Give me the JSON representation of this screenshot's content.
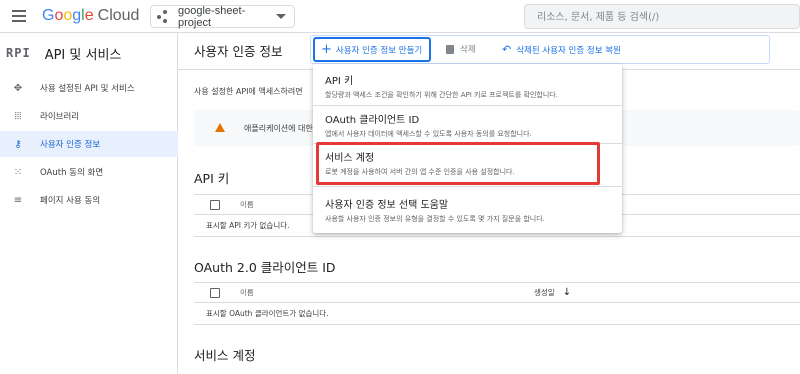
{
  "header": {
    "logo_google": "Google",
    "logo_cloud": "Cloud",
    "project_name": "google-sheet-project",
    "search_placeholder": "리소스, 문서, 제품 등 검색(/)"
  },
  "sidebar": {
    "api_logo": "RPI",
    "title": "API 및 서비스",
    "items": [
      {
        "label": "사용 설정된 API 및 서비스",
        "icon": "diamond-grid-icon",
        "active": false
      },
      {
        "label": "라이브러리",
        "icon": "library-icon",
        "active": false
      },
      {
        "label": "사용자 인증 정보",
        "icon": "key-icon",
        "active": true
      },
      {
        "label": "OAuth 동의 화면",
        "icon": "consent-dots-icon",
        "active": false
      },
      {
        "label": "페이지 사용 동의",
        "icon": "settings-list-icon",
        "active": false
      }
    ]
  },
  "main": {
    "title": "사용자 인증 정보",
    "toolbar": {
      "create_label": "사용자 인증 정보 만들기",
      "delete_label": "삭제",
      "restore_label": "삭제된 사용자 인증 정보 복원"
    },
    "intro_text": "사용 설정한 API에 액세스하려면",
    "warning_text": "애플리케이션에 대한",
    "sections": {
      "api_keys": {
        "title": "API 키",
        "col_name": "이름",
        "empty": "표시할 API 키가 없습니다."
      },
      "oauth": {
        "title": "OAuth 2.0 클라이언트 ID",
        "col_name": "이름",
        "col_created": "생성일",
        "empty": "표시할 OAuth 클라이언트가 없습니다."
      },
      "service": {
        "title": "서비스 계정"
      }
    }
  },
  "menu": {
    "items": [
      {
        "title": "API 키",
        "desc": "할당량과 액세스 조건을 확인하기 위해 간단한 API 키로 프로젝트를 확인합니다."
      },
      {
        "title": "OAuth 클라이언트 ID",
        "desc": "앱에서 사용자 데이터에 액세스할 수 있도록 사용자 동의를 요청합니다."
      },
      {
        "title": "서비스 계정",
        "desc": "로봇 계정을 사용하여 서버 간의 앱 수준 인증을 사용 설정합니다."
      },
      {
        "title": "사용자 인증 정보 선택 도움말",
        "desc": "사용할 사용자 인증 정보의 유형을 결정할 수 있도록 몇 가지 질문을 합니다."
      }
    ]
  },
  "colors": {
    "accent": "#1a73e8",
    "active_bg": "#e8f0fe",
    "highlight": "#e53935",
    "warning": "#e37400"
  }
}
